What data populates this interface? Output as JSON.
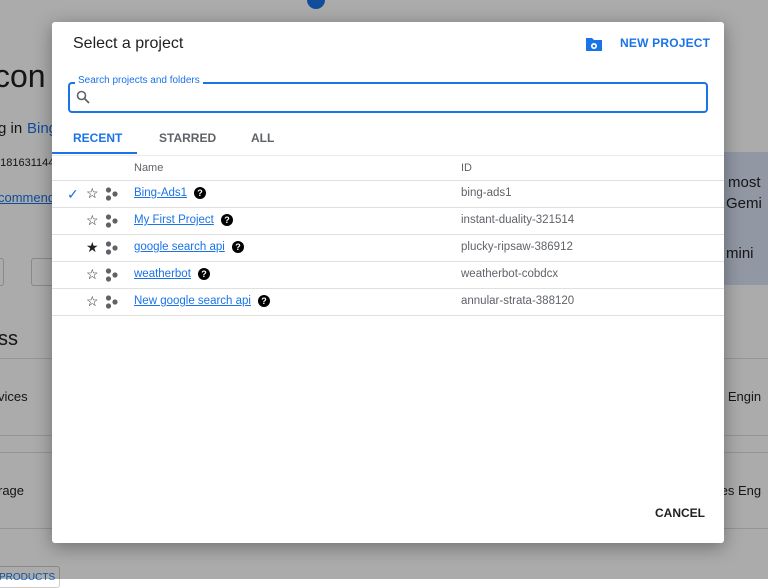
{
  "background": {
    "fragments": [
      "con",
      "g in",
      "Bing",
      "5181631144",
      "commend",
      "ss",
      "vices",
      "rage",
      "most",
      "Gemi",
      "mini",
      "e Engin",
      "tes Eng",
      "PRODUCTS"
    ]
  },
  "dialog": {
    "title": "Select a project",
    "new_project_label": "NEW PROJECT",
    "new_project_icon": "folder-gear-icon",
    "search": {
      "label": "Search projects and folders",
      "value": "",
      "placeholder": ""
    },
    "tabs": [
      {
        "label": "RECENT",
        "active": true
      },
      {
        "label": "STARRED",
        "active": false
      },
      {
        "label": "ALL",
        "active": false
      }
    ],
    "columns": {
      "name": "Name",
      "id": "ID"
    },
    "projects": [
      {
        "name": "Bing-Ads1",
        "id": "bing-ads1",
        "selected": true,
        "starred": false
      },
      {
        "name": "My First Project",
        "id": "instant-duality-321514",
        "selected": false,
        "starred": false
      },
      {
        "name": "google search api",
        "id": "plucky-ripsaw-386912",
        "selected": false,
        "starred": true
      },
      {
        "name": "weatherbot",
        "id": "weatherbot-cobdcx",
        "selected": false,
        "starred": false
      },
      {
        "name": "New google search api",
        "id": "annular-strata-388120",
        "selected": false,
        "starred": false
      }
    ],
    "cancel_label": "CANCEL",
    "accent": "#1a73e8"
  }
}
